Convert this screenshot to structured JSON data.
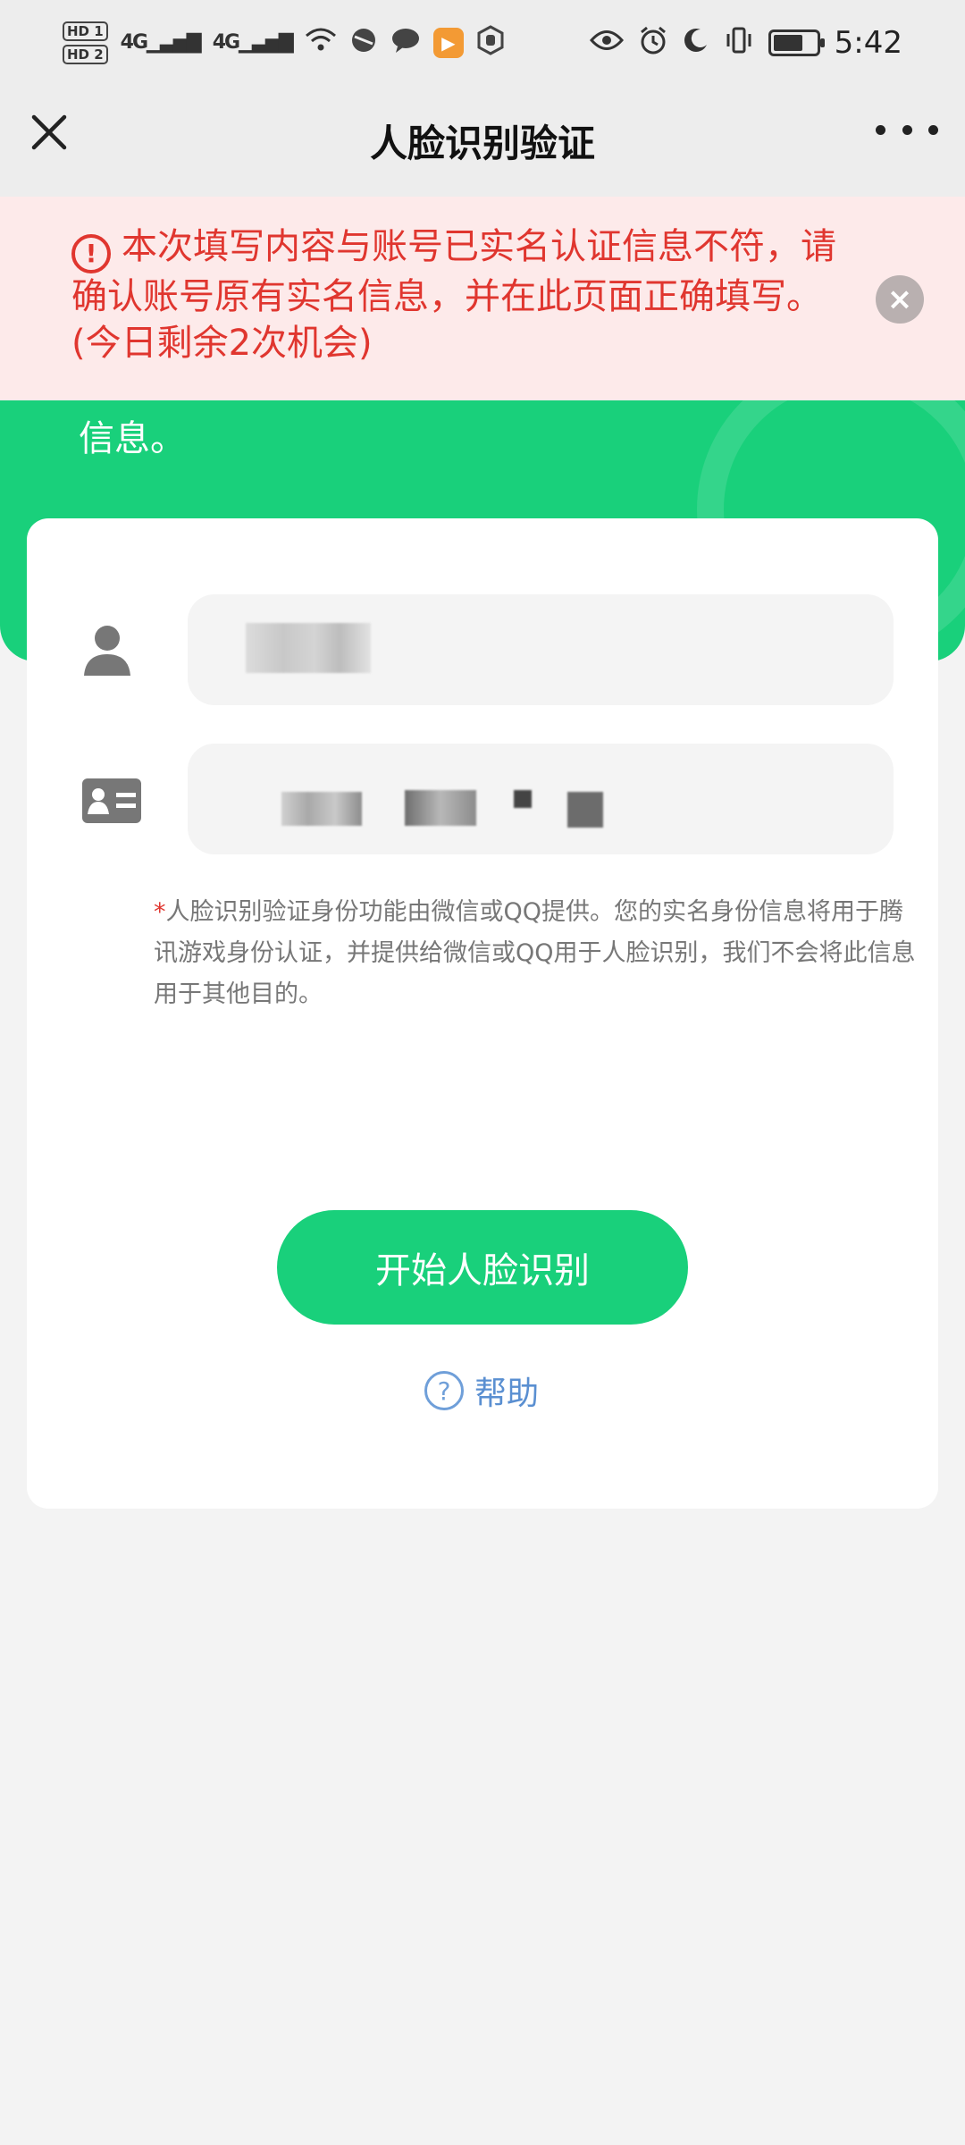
{
  "status_bar": {
    "hd1": "HD 1",
    "hd2": "HD 2",
    "sig1": "4G",
    "sig2": "4G",
    "time": "5:42",
    "icons": [
      "wifi-icon",
      "browser-icon",
      "chat-icon",
      "video-app-icon",
      "hand-icon",
      "eye-icon",
      "alarm-icon",
      "moon-icon",
      "vibrate-icon",
      "battery-icon"
    ]
  },
  "nav": {
    "title": "人脸识别验证"
  },
  "error_banner": {
    "icon": "!",
    "message": "本次填写内容与账号已实名认证信息不符，请确认账号原有实名信息，并在此页面正确填写。(今日剩余2次机会)",
    "close": "×"
  },
  "banner": {
    "text": "信息。"
  },
  "form": {
    "name_value": "",
    "id_value": "",
    "note_star": "*",
    "note": "人脸识别验证身份功能由微信或QQ提供。您的实名身份信息将用于腾讯游戏身份认证，并提供给微信或QQ用于人脸识别，我们不会将此信息用于其他目的。",
    "start_button": "开始人脸识别",
    "help_icon": "?",
    "help_label": "帮助"
  },
  "colors": {
    "brand_green": "#19d07b",
    "error_red": "#e0362f",
    "error_bg": "#fdeaea",
    "help_blue": "#5a8fd1"
  }
}
